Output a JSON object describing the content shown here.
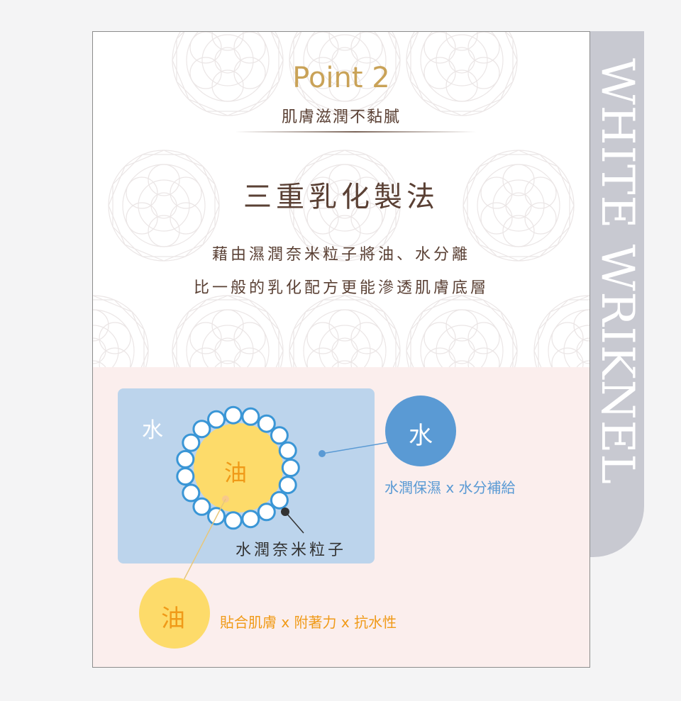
{
  "side": {
    "brand_text": "WHITE WRIKNEL"
  },
  "header": {
    "point_title": "Point 2",
    "subtitle": "肌膚滋潤不黏膩"
  },
  "headline": "三重乳化製法",
  "description": {
    "line1": "藉由濕潤奈米粒子將油、水分離",
    "line2": "比一般的乳化配方更能滲透肌膚底層"
  },
  "diagram": {
    "water_panel_label": "水",
    "oil_center_label": "油",
    "nano_particle_label": "水潤奈米粒子",
    "water_circle_label": "水",
    "water_benefit": "水潤保濕 x 水分補給",
    "oil_circle_label": "油",
    "oil_benefit": "貼合肌膚 x 附著力 x 抗水性"
  },
  "colors": {
    "gold": "#c9a257",
    "brown": "#5a4034",
    "water_blue": "#5a9ad4",
    "panel_blue": "#bcd4ec",
    "oil_yellow": "#fddb6a",
    "oil_orange": "#f09a18",
    "pink_bg": "#fbeeed",
    "side_gray": "#c8c9d1"
  },
  "icons": [
    "mandala-pattern-icon",
    "nano-particle-ring-icon"
  ]
}
